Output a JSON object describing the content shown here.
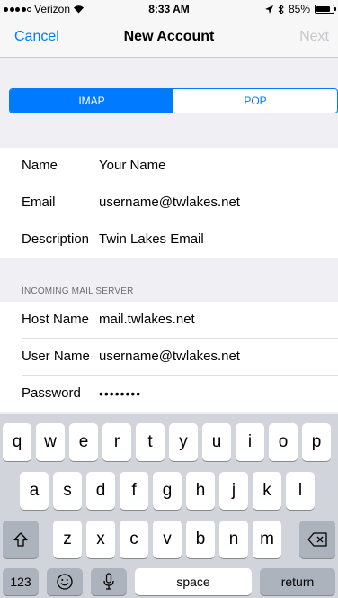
{
  "status_bar": {
    "carrier": "Verizon",
    "time": "8:33 AM",
    "battery": "85%",
    "battery_level": 0.85
  },
  "nav": {
    "cancel": "Cancel",
    "title": "New Account",
    "next": "Next"
  },
  "segmented": {
    "options": [
      "IMAP",
      "POP"
    ],
    "selected": "IMAP"
  },
  "account": {
    "name_label": "Name",
    "name_value": "Your Name",
    "email_label": "Email",
    "email_value": "username@twlakes.net",
    "description_label": "Description",
    "description_value": "Twin Lakes Email"
  },
  "incoming": {
    "header": "INCOMING MAIL SERVER",
    "host_label": "Host Name",
    "host_value": "mail.twlakes.net",
    "user_label": "User Name",
    "user_value": "username@twlakes.net",
    "password_label": "Password",
    "password_value": "••••••••"
  },
  "keyboard": {
    "row1": [
      "q",
      "w",
      "e",
      "r",
      "t",
      "y",
      "u",
      "i",
      "o",
      "p"
    ],
    "row2": [
      "a",
      "s",
      "d",
      "f",
      "g",
      "h",
      "j",
      "k",
      "l"
    ],
    "row3": [
      "z",
      "x",
      "c",
      "v",
      "b",
      "n",
      "m"
    ],
    "numbers": "123",
    "space": "space",
    "return": "return",
    "shift_icon": "shift-icon",
    "delete_icon": "delete-icon",
    "emoji_icon": "emoji-icon",
    "mic_icon": "microphone-icon"
  },
  "colors": {
    "accent": "#007aff",
    "disabled": "#c7c7cc"
  }
}
